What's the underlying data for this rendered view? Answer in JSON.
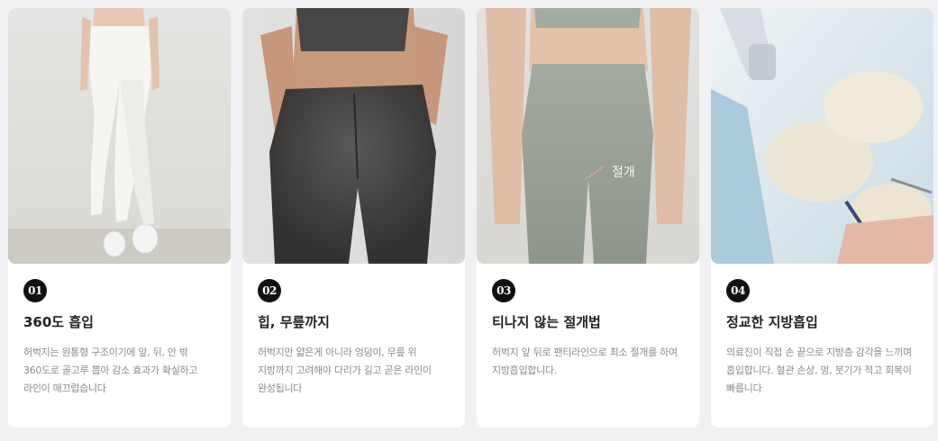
{
  "cards": [
    {
      "number": "01",
      "title": "360도 흡입",
      "desc_lines": [
        "허벅지는 원통형 구조이기에 앞, 뒤, 안 밖",
        "360도로 골고루 뽑아 감소 효과가 확실하고",
        "라인이 매끄럽습니다"
      ],
      "image": "white-leggings-legs"
    },
    {
      "number": "02",
      "title": "힙, 무릎까지",
      "desc_lines": [
        "허벅지만 얇은게 아니라 엉덩이, 무릎 위",
        "지방까지 고려해야 다리가 길고 곧은 라인이",
        "완성됩니다"
      ],
      "image": "dark-leggings-back"
    },
    {
      "number": "03",
      "title": "티나지 않는 절개법",
      "desc_lines": [
        "허벅지 앞 뒤로 팬티라인으로 최소 절개를 하여",
        "지방흡입합니다."
      ],
      "image": "sage-leggings-front",
      "photo_label": "절개"
    },
    {
      "number": "04",
      "title": "정교한 지방흡입",
      "desc_lines": [
        "의료진이 직접 손 끝으로 지방층 감각을 느끼며",
        "흡입합니다. 혈관 손상, 멍, 붓기가 적고 회복이",
        "빠릅니다"
      ],
      "image": "surgery-gloved-hands"
    }
  ],
  "colors": {
    "background": "#f1f1f3",
    "card": "#ffffff",
    "badge": "#111111",
    "title": "#222222",
    "desc": "#8a8a8a"
  }
}
